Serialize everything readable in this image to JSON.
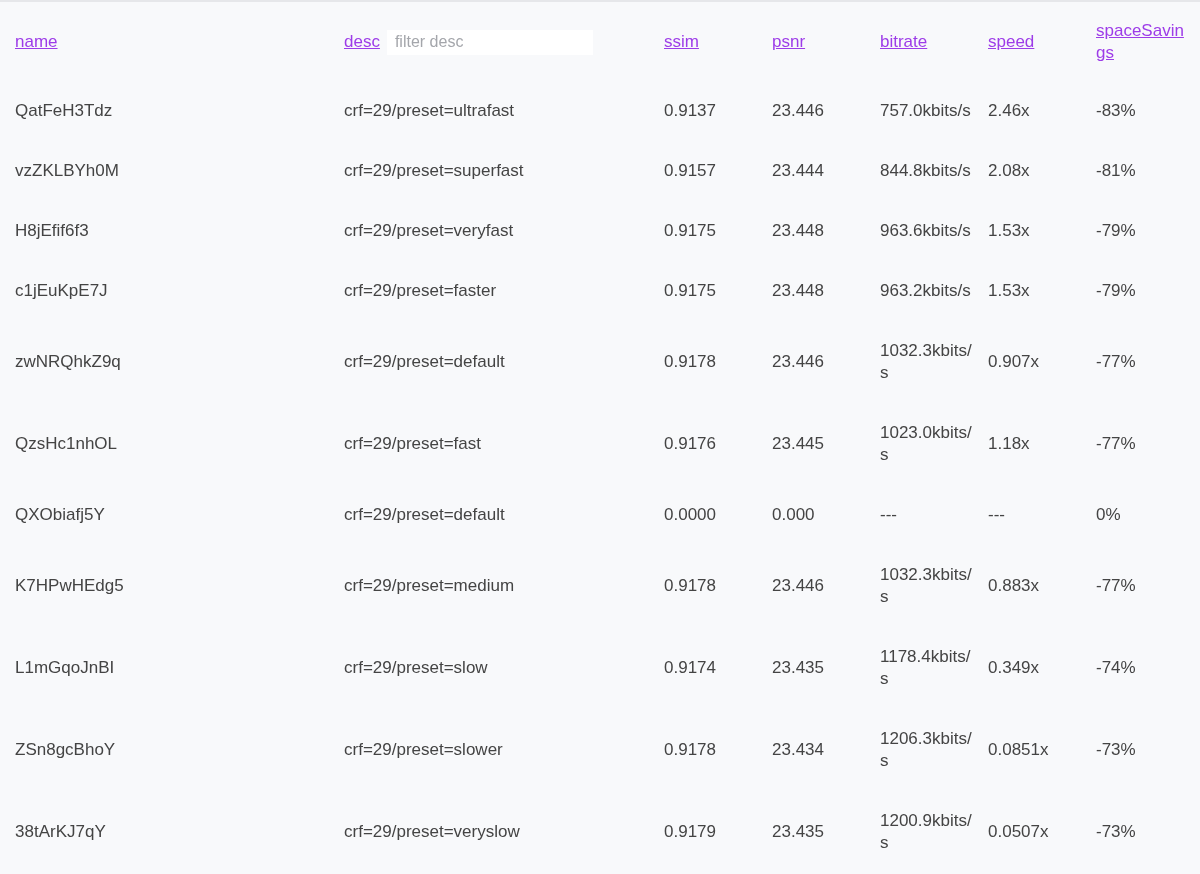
{
  "table": {
    "columns": [
      {
        "label": "name"
      },
      {
        "label": "desc",
        "filter": {
          "placeholder": "filter desc"
        }
      },
      {
        "label": "ssim"
      },
      {
        "label": "psnr"
      },
      {
        "label": "bitrate"
      },
      {
        "label": "speed"
      },
      {
        "label": "spaceSavings"
      }
    ],
    "rows": [
      [
        "QatFeH3Tdz",
        "crf=29/preset=ultrafast",
        "0.9137",
        "23.446",
        "757.0kbits/s",
        "2.46x",
        "-83%"
      ],
      [
        "vzZKLBYh0M",
        "crf=29/preset=superfast",
        "0.9157",
        "23.444",
        "844.8kbits/s",
        "2.08x",
        "-81%"
      ],
      [
        "H8jEfif6f3",
        "crf=29/preset=veryfast",
        "0.9175",
        "23.448",
        "963.6kbits/s",
        "1.53x",
        "-79%"
      ],
      [
        "c1jEuKpE7J",
        "crf=29/preset=faster",
        "0.9175",
        "23.448",
        "963.2kbits/s",
        "1.53x",
        "-79%"
      ],
      [
        "zwNRQhkZ9q",
        "crf=29/preset=default",
        "0.9178",
        "23.446",
        "1032.3kbits/s",
        "0.907x",
        "-77%"
      ],
      [
        "QzsHc1nhOL",
        "crf=29/preset=fast",
        "0.9176",
        "23.445",
        "1023.0kbits/s",
        "1.18x",
        "-77%"
      ],
      [
        "QXObiafj5Y",
        "crf=29/preset=default",
        "0.0000",
        "0.000",
        "---",
        "---",
        "0%"
      ],
      [
        "K7HPwHEdg5",
        "crf=29/preset=medium",
        "0.9178",
        "23.446",
        "1032.3kbits/s",
        "0.883x",
        "-77%"
      ],
      [
        "L1mGqoJnBI",
        "crf=29/preset=slow",
        "0.9174",
        "23.435",
        "1178.4kbits/s",
        "0.349x",
        "-74%"
      ],
      [
        "ZSn8gcBhoY",
        "crf=29/preset=slower",
        "0.9178",
        "23.434",
        "1206.3kbits/s",
        "0.0851x",
        "-73%"
      ],
      [
        "38tArKJ7qY",
        "crf=29/preset=veryslow",
        "0.9179",
        "23.435",
        "1200.9kbits/s",
        "0.0507x",
        "-73%"
      ]
    ]
  }
}
